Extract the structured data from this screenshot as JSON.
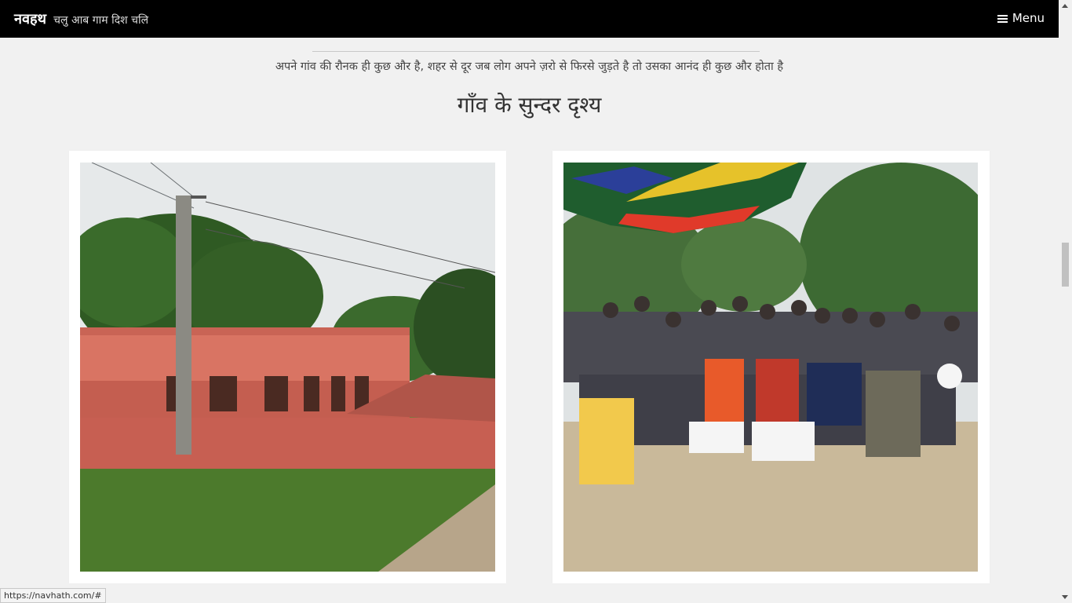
{
  "header": {
    "brand_name": "नवहथ",
    "tagline": "चलु आब गाम दिश चलि",
    "menu_label": "Menu",
    "menu_icon": "bars-icon"
  },
  "main": {
    "intro_text": "अपने गांव की रौनक ही कुछ और है, शहर से दूर जब लोग अपने ज़रो से फिरसे जुड़ते है तो उसका आनंद ही कुछ और होता है",
    "section_title": "गाँव के सुन्दर दृश्य"
  },
  "gallery": [
    {
      "subject": "village school building with pole"
    },
    {
      "subject": "group of villagers under a tent"
    }
  ],
  "status_bar": {
    "url": "https://navhath.com/#"
  }
}
